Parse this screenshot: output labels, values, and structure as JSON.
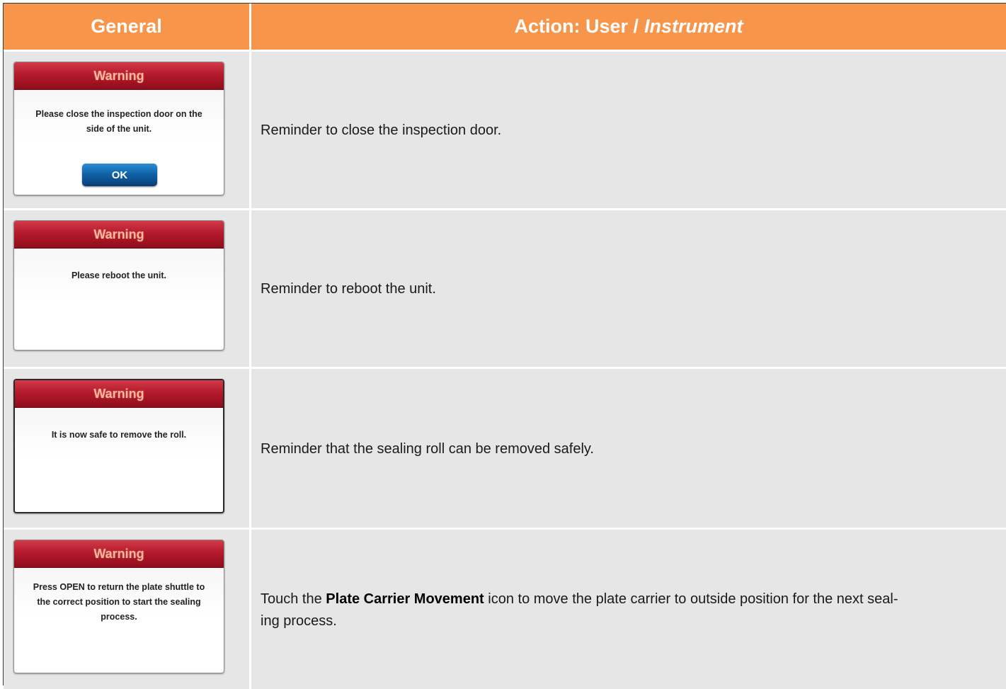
{
  "header": {
    "col1": "General",
    "col2_prefix": "Action: User /",
    "col2_italic": "Instrument"
  },
  "rows": [
    {
      "dialog": {
        "title": "Warning",
        "message": "Please close the inspection door on the side of the unit.",
        "button": "OK"
      },
      "description": "Reminder to close the inspection door."
    },
    {
      "dialog": {
        "title": "Warning",
        "message": "Please reboot the unit."
      },
      "description": "Reminder to reboot the unit."
    },
    {
      "dialog": {
        "title": "Warning",
        "message": "It is now safe to remove the roll."
      },
      "description": "Reminder that the sealing roll can be removed safely."
    },
    {
      "dialog": {
        "title": "Warning",
        "message": "Press OPEN to return the plate shuttle to the correct position to start the sealing process."
      },
      "description_before": "Touch the",
      "description_bold": "Plate Carrier Movement",
      "description_after": "icon to move the plate carrier to outside position for the next seal-",
      "description_line2": "ing process."
    }
  ]
}
